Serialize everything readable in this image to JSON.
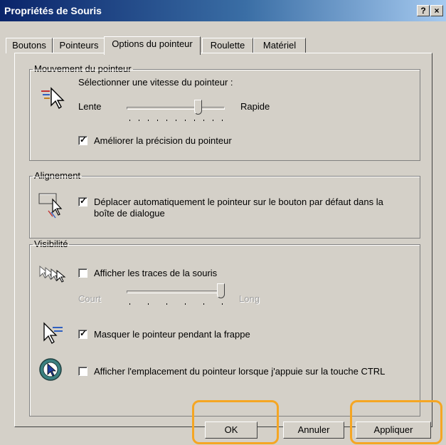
{
  "window": {
    "title": "Propriétés de Souris",
    "help_label": "?",
    "close_label": "×"
  },
  "tabs": [
    "Boutons",
    "Pointeurs",
    "Options du pointeur",
    "Roulette",
    "Matériel"
  ],
  "motion": {
    "group_label": "Mouvement du pointeur",
    "speed_label": "Sélectionner une vitesse du pointeur :",
    "slow_label": "Lente",
    "fast_label": "Rapide",
    "speed_level": 0.75,
    "precision_label": "Améliorer la précision du pointeur",
    "precision_checked": true
  },
  "snap": {
    "group_label": "Alignement",
    "snap_label_line1": "Déplacer automatiquement le pointeur sur le bouton par défaut dans la",
    "snap_label_line2": "boîte de dialogue",
    "snap_checked": true
  },
  "visibility": {
    "group_label": "Visibilité",
    "trails_label": "Afficher les traces de la souris",
    "trails_checked": false,
    "short_label": "Court",
    "long_label": "Long",
    "trails_level": 1.0,
    "hide_label": "Masquer le pointeur pendant la frappe",
    "hide_checked": true,
    "ctrl_label": "Afficher l'emplacement du pointeur lorsque j'appuie sur la touche CTRL",
    "ctrl_checked": false
  },
  "buttons": {
    "ok": "OK",
    "cancel": "Annuler",
    "apply": "Appliquer"
  },
  "colors": {
    "highlight": "#f5a623",
    "face": "#d4d0c8",
    "title_start": "#0a246a"
  },
  "icons": [
    "pointer-speed-icon",
    "snap-to-icon",
    "pointer-trails-icon",
    "hide-pointer-icon",
    "ctrl-locate-icon"
  ]
}
